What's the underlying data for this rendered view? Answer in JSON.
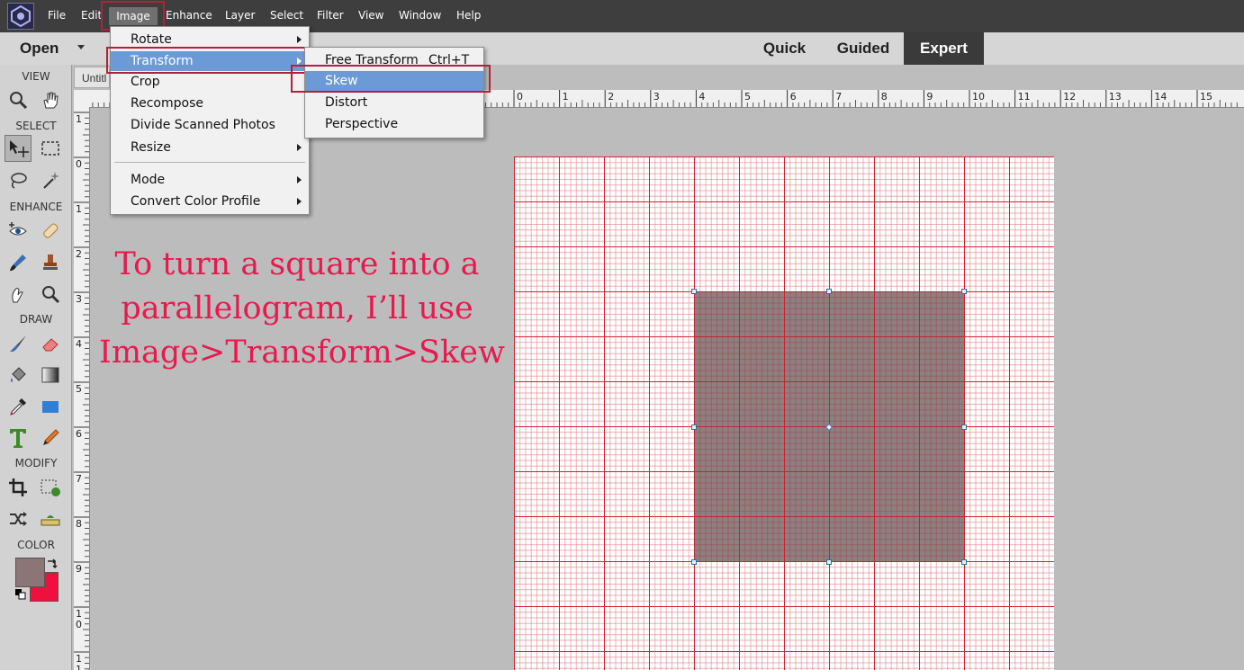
{
  "menubar": {
    "items": [
      "File",
      "Edit",
      "Image",
      "Enhance",
      "Layer",
      "Select",
      "Filter",
      "View",
      "Window",
      "Help"
    ]
  },
  "modebar": {
    "open_label": "Open",
    "tabs": [
      "Quick",
      "Guided",
      "Expert"
    ],
    "active_tab": "Expert"
  },
  "document": {
    "tab_label": "Untitl"
  },
  "toolbox": {
    "sections": [
      "VIEW",
      "SELECT",
      "ENHANCE",
      "DRAW",
      "MODIFY",
      "COLOR"
    ],
    "tools": [
      "zoom-icon",
      "hand-icon",
      "move-icon",
      "marquee-icon",
      "lasso-icon",
      "magic-wand-icon",
      "red-eye-icon",
      "spot-healing-icon",
      "quick-selection-brush-icon",
      "clone-stamp-icon",
      "smudge-icon",
      "zoom-small-icon",
      "brush-icon",
      "eraser-icon",
      "paint-bucket-icon",
      "gradient-icon",
      "eyedropper-icon",
      "rectangle-shape-icon",
      "type-icon",
      "pencil-icon",
      "crop-icon",
      "recompose-icon",
      "content-aware-move-icon",
      "straighten-icon"
    ],
    "foreground_color": "#8e7575",
    "background_color": "#f0103e"
  },
  "image_menu": {
    "items": [
      {
        "label": "Rotate",
        "submenu": true
      },
      {
        "label": "Transform",
        "submenu": true
      },
      {
        "label": "Crop",
        "submenu": false
      },
      {
        "label": "Recompose",
        "submenu": false
      },
      {
        "label": "Divide Scanned Photos",
        "submenu": false
      },
      {
        "label": "Resize",
        "submenu": true
      },
      {
        "label": "Mode",
        "submenu": true
      },
      {
        "label": "Convert Color Profile",
        "submenu": true
      }
    ],
    "highlighted": "Transform"
  },
  "transform_submenu": {
    "free_transform": {
      "label": "Free Transform",
      "shortcut": "Ctrl+T"
    },
    "items": [
      "Skew",
      "Distort",
      "Perspective"
    ],
    "highlighted": "Skew"
  },
  "rulers": {
    "horizontal": [
      "0",
      "1",
      "2",
      "3",
      "4",
      "5",
      "6",
      "7",
      "8",
      "9",
      "10",
      "11",
      "12",
      "13",
      "14",
      "15"
    ],
    "vertical": [
      "1",
      "0",
      "1",
      "2",
      "3",
      "4",
      "5",
      "6",
      "7",
      "8",
      "9",
      "1\n0",
      "1\n1"
    ]
  },
  "annotation": {
    "lines": [
      "To turn a square into a",
      "parallelogram, I’ll use",
      "Image>Transform>Skew"
    ],
    "color": "#e8194d"
  }
}
